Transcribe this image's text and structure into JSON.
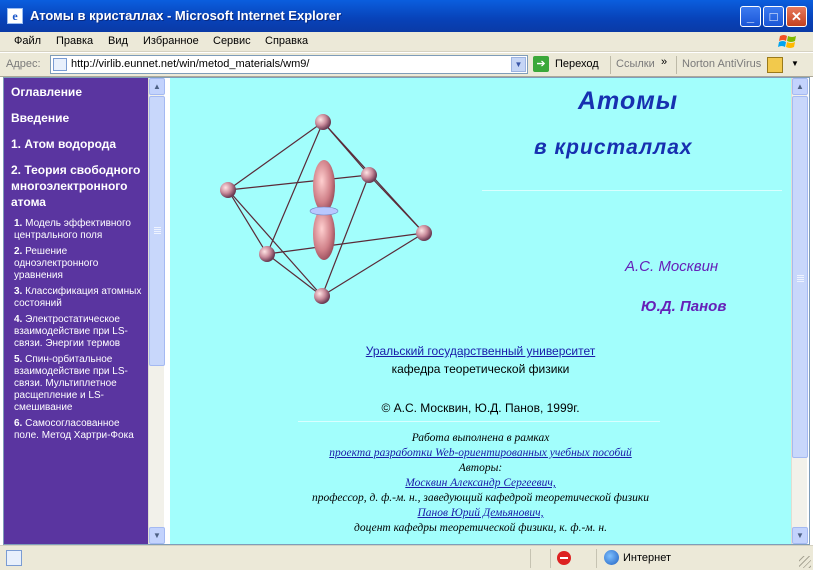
{
  "window": {
    "title": "Атомы в кристаллах - Microsoft Internet Explorer",
    "minimize": "_",
    "maximize": "□",
    "close": "✕"
  },
  "menu": [
    "Файл",
    "Правка",
    "Вид",
    "Избранное",
    "Сервис",
    "Справка"
  ],
  "address": {
    "label": "Адрес:",
    "url": "http://virlib.eunnet.net/win/metod_materials/wm9/",
    "go": "Переход",
    "links": "Ссылки",
    "links_more": "»",
    "toolbar": "Norton AntiVirus"
  },
  "nav": {
    "toc": "Оглавление",
    "intro": "Введение",
    "ch1": "1. Атом водорода",
    "ch2": "2. Теория свободного многоэлектронного атома",
    "items": [
      {
        "num": "1.",
        "text": "Модель эффективного центрального поля"
      },
      {
        "num": "2.",
        "text": "Решение одноэлектронного уравнения"
      },
      {
        "num": "3.",
        "text": "Классификация атомных состояний"
      },
      {
        "num": "4.",
        "text": "Электростатическое взаимодействие при LS-связи. Энергии термов"
      },
      {
        "num": "5.",
        "text": "Спин-орбитальное взаимодействие при LS-связи. Мультиплетное расщепление и LS-смешивание"
      },
      {
        "num": "6.",
        "text": "Самосогласованное поле. Метод Хартри-Фока"
      }
    ]
  },
  "main": {
    "title_line1": "Атомы",
    "title_line2": "в кристаллах",
    "author1": "А.С. Москвин",
    "author2": "Ю.Д. Панов",
    "university": "Уральский государственный университет",
    "department": "кафедра теоретической физики",
    "copyright": "© А.С. Москвин, Ю.Д. Панов, 1999г.",
    "project_intro": "Работа выполнена в рамках",
    "project_link": "проекта разработки Web-ориентированных учебных пособий",
    "authors_label": "Авторы:",
    "author1_link": "Москвин Александр Сергеевич,",
    "author1_role": "профессор, д. ф.-м. н., заведующий кафедрой теоретической физики",
    "author2_link": "Панов Юрий Демьянович,",
    "author2_role": "доцент кафедры теоретической физики, к. ф.-м. н."
  },
  "status": {
    "zone": "Интернет"
  },
  "colors": {
    "nav_bg": "#5a35a0",
    "page_bg": "#a2fefc",
    "title_color": "#1730b0",
    "author_color": "#6620b8"
  }
}
